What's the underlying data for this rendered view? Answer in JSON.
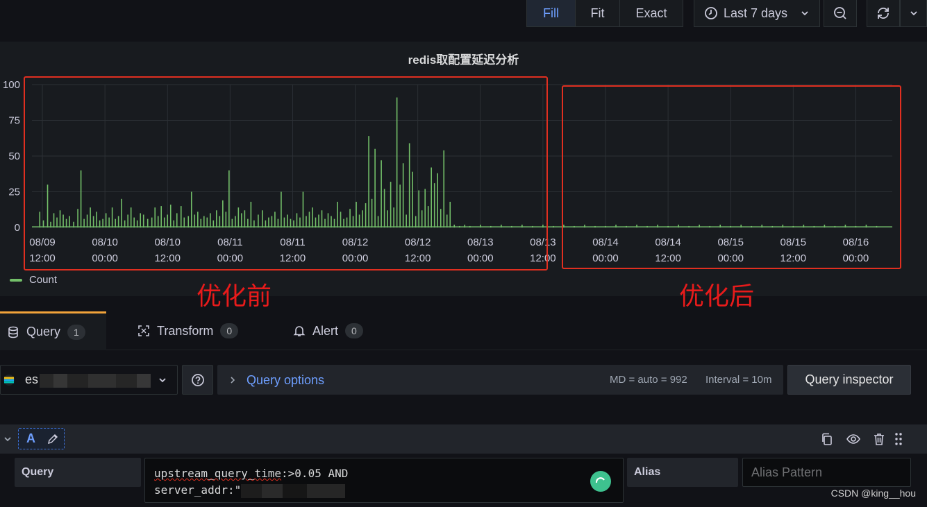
{
  "toolbar": {
    "fill_label": "Fill",
    "fit_label": "Fit",
    "exact_label": "Exact",
    "time_range_label": "Last 7 days"
  },
  "panel": {
    "title": "redis取配置延迟分析",
    "legend_label": "Count",
    "series_color": "#73bf69"
  },
  "annotations": {
    "before_label": "优化前",
    "after_label": "优化后",
    "color": "#e02f20"
  },
  "chart_data": {
    "type": "bar",
    "title": "redis取配置延迟分析",
    "xlabel": "",
    "ylabel": "",
    "ylim": [
      0,
      100
    ],
    "yticks": [
      "100",
      "75",
      "50",
      "25",
      "0"
    ],
    "xticks": [
      {
        "date": "08/09",
        "time": "12:00"
      },
      {
        "date": "08/10",
        "time": "00:00"
      },
      {
        "date": "08/10",
        "time": "12:00"
      },
      {
        "date": "08/11",
        "time": "00:00"
      },
      {
        "date": "08/11",
        "time": "12:00"
      },
      {
        "date": "08/12",
        "time": "00:00"
      },
      {
        "date": "08/12",
        "time": "12:00"
      },
      {
        "date": "08/13",
        "time": "00:00"
      },
      {
        "date": "08/13",
        "time": "12:00"
      },
      {
        "date": "08/14",
        "time": "00:00"
      },
      {
        "date": "08/14",
        "time": "12:00"
      },
      {
        "date": "08/15",
        "time": "00:00"
      },
      {
        "date": "08/15",
        "time": "12:00"
      },
      {
        "date": "08/16",
        "time": "00:00"
      }
    ],
    "x_range_hours": [
      -2,
      163
    ],
    "series": [
      {
        "name": "Count",
        "points": [
          [
            -0.5,
            11
          ],
          [
            0.2,
            5
          ],
          [
            1,
            30
          ],
          [
            1.6,
            4
          ],
          [
            2.2,
            10
          ],
          [
            2.8,
            7
          ],
          [
            3.4,
            12
          ],
          [
            4,
            9
          ],
          [
            4.6,
            6
          ],
          [
            5.2,
            8
          ],
          [
            6,
            4
          ],
          [
            6.8,
            13
          ],
          [
            7.4,
            40
          ],
          [
            8,
            6
          ],
          [
            8.6,
            9
          ],
          [
            9.2,
            14
          ],
          [
            9.8,
            8
          ],
          [
            10.4,
            11
          ],
          [
            11,
            5
          ],
          [
            11.6,
            6
          ],
          [
            12.2,
            10
          ],
          [
            12.8,
            7
          ],
          [
            13.4,
            14
          ],
          [
            14,
            6
          ],
          [
            14.6,
            8
          ],
          [
            15.2,
            20
          ],
          [
            15.8,
            5
          ],
          [
            16.4,
            9
          ],
          [
            17,
            14
          ],
          [
            17.6,
            7
          ],
          [
            18.2,
            5
          ],
          [
            18.8,
            10
          ],
          [
            19.4,
            9
          ],
          [
            20.2,
            6
          ],
          [
            21,
            7
          ],
          [
            21.6,
            14
          ],
          [
            22.2,
            8
          ],
          [
            22.8,
            15
          ],
          [
            23.4,
            7
          ],
          [
            24,
            9
          ],
          [
            24.6,
            16
          ],
          [
            25.2,
            5
          ],
          [
            25.8,
            10
          ],
          [
            26.6,
            15
          ],
          [
            27.2,
            7
          ],
          [
            28,
            8
          ],
          [
            28.6,
            25
          ],
          [
            29.2,
            9
          ],
          [
            29.8,
            11
          ],
          [
            30.4,
            6
          ],
          [
            31,
            8
          ],
          [
            31.6,
            7
          ],
          [
            32.2,
            10
          ],
          [
            32.8,
            5
          ],
          [
            33.4,
            12
          ],
          [
            34,
            8
          ],
          [
            34.6,
            19
          ],
          [
            35.2,
            11
          ],
          [
            35.8,
            40
          ],
          [
            36.4,
            6
          ],
          [
            37,
            8
          ],
          [
            37.6,
            14
          ],
          [
            38.2,
            10
          ],
          [
            38.8,
            12
          ],
          [
            39.4,
            6
          ],
          [
            40,
            18
          ],
          [
            40.6,
            5
          ],
          [
            41.4,
            9
          ],
          [
            42.2,
            12
          ],
          [
            42.8,
            5
          ],
          [
            43.4,
            7
          ],
          [
            44,
            8
          ],
          [
            44.6,
            11
          ],
          [
            45.2,
            6
          ],
          [
            45.8,
            25
          ],
          [
            46.4,
            7
          ],
          [
            47,
            9
          ],
          [
            47.6,
            6
          ],
          [
            48.2,
            5
          ],
          [
            48.8,
            10
          ],
          [
            49.4,
            7
          ],
          [
            50,
            25
          ],
          [
            50.6,
            8
          ],
          [
            51.2,
            11
          ],
          [
            51.8,
            14
          ],
          [
            52.4,
            7
          ],
          [
            53,
            9
          ],
          [
            53.6,
            12
          ],
          [
            54.2,
            6
          ],
          [
            54.8,
            10
          ],
          [
            55.4,
            8
          ],
          [
            56,
            6
          ],
          [
            56.6,
            18
          ],
          [
            57.2,
            11
          ],
          [
            57.8,
            6
          ],
          [
            58.4,
            7
          ],
          [
            59,
            13
          ],
          [
            59.6,
            8
          ],
          [
            60.2,
            18
          ],
          [
            60.8,
            9
          ],
          [
            61.4,
            12
          ],
          [
            62,
            17
          ],
          [
            62.6,
            64
          ],
          [
            63.2,
            20
          ],
          [
            63.8,
            55
          ],
          [
            64.4,
            8
          ],
          [
            65,
            47
          ],
          [
            65.6,
            27
          ],
          [
            66.2,
            12
          ],
          [
            66.8,
            32
          ],
          [
            67.4,
            14
          ],
          [
            68,
            91
          ],
          [
            68.6,
            30
          ],
          [
            69.2,
            45
          ],
          [
            69.8,
            9
          ],
          [
            70.4,
            59
          ],
          [
            71,
            39
          ],
          [
            71.6,
            8
          ],
          [
            72.2,
            26
          ],
          [
            72.8,
            12
          ],
          [
            73.4,
            27
          ],
          [
            74,
            15
          ],
          [
            74.6,
            42
          ],
          [
            75.2,
            31
          ],
          [
            75.8,
            38
          ],
          [
            76.4,
            13
          ],
          [
            77,
            54
          ],
          [
            77.6,
            9
          ],
          [
            78.2,
            18
          ],
          [
            79,
            2
          ],
          [
            80,
            1
          ],
          [
            81,
            2
          ],
          [
            82,
            1
          ],
          [
            84,
            2
          ],
          [
            86,
            1
          ],
          [
            88,
            2
          ],
          [
            90,
            1
          ],
          [
            92,
            2
          ],
          [
            94,
            1
          ],
          [
            96,
            2
          ],
          [
            98,
            1
          ],
          [
            100,
            2
          ],
          [
            102,
            1
          ],
          [
            104,
            2
          ],
          [
            106,
            1
          ],
          [
            108,
            1
          ],
          [
            110,
            2
          ],
          [
            112,
            1
          ],
          [
            114,
            2
          ],
          [
            116,
            1
          ],
          [
            118,
            2
          ],
          [
            120,
            1
          ],
          [
            122,
            2
          ],
          [
            124,
            1
          ],
          [
            126,
            2
          ],
          [
            128,
            1
          ],
          [
            130,
            2
          ],
          [
            132,
            1
          ],
          [
            134,
            2
          ],
          [
            136,
            1
          ],
          [
            138,
            2
          ],
          [
            140,
            1
          ],
          [
            142,
            2
          ],
          [
            144,
            1
          ],
          [
            146,
            2
          ],
          [
            148,
            1
          ],
          [
            150,
            2
          ],
          [
            152,
            1
          ],
          [
            154,
            2
          ],
          [
            156,
            1
          ],
          [
            158,
            2
          ],
          [
            160,
            1
          ]
        ]
      }
    ],
    "grid": true,
    "legend": "bottom-left"
  },
  "tabs": {
    "query_label": "Query",
    "query_count": "1",
    "transform_label": "Transform",
    "transform_count": "0",
    "alert_label": "Alert",
    "alert_count": "0"
  },
  "datasource": {
    "name": "es",
    "icon": "elasticsearch-icon"
  },
  "query_options": {
    "label": "Query options",
    "md_text": "MD = auto = 992",
    "interval_text": "Interval = 10m",
    "inspector_label": "Query inspector"
  },
  "query": {
    "ref_id": "A",
    "field_label": "Query",
    "line1_keyword": "upstream_query_time",
    "line1_rest": ":>0.05 AND",
    "line2": "server_addr:\"",
    "alias_label": "Alias",
    "alias_placeholder": "Alias Pattern"
  },
  "watermark": "CSDN @king__hou"
}
